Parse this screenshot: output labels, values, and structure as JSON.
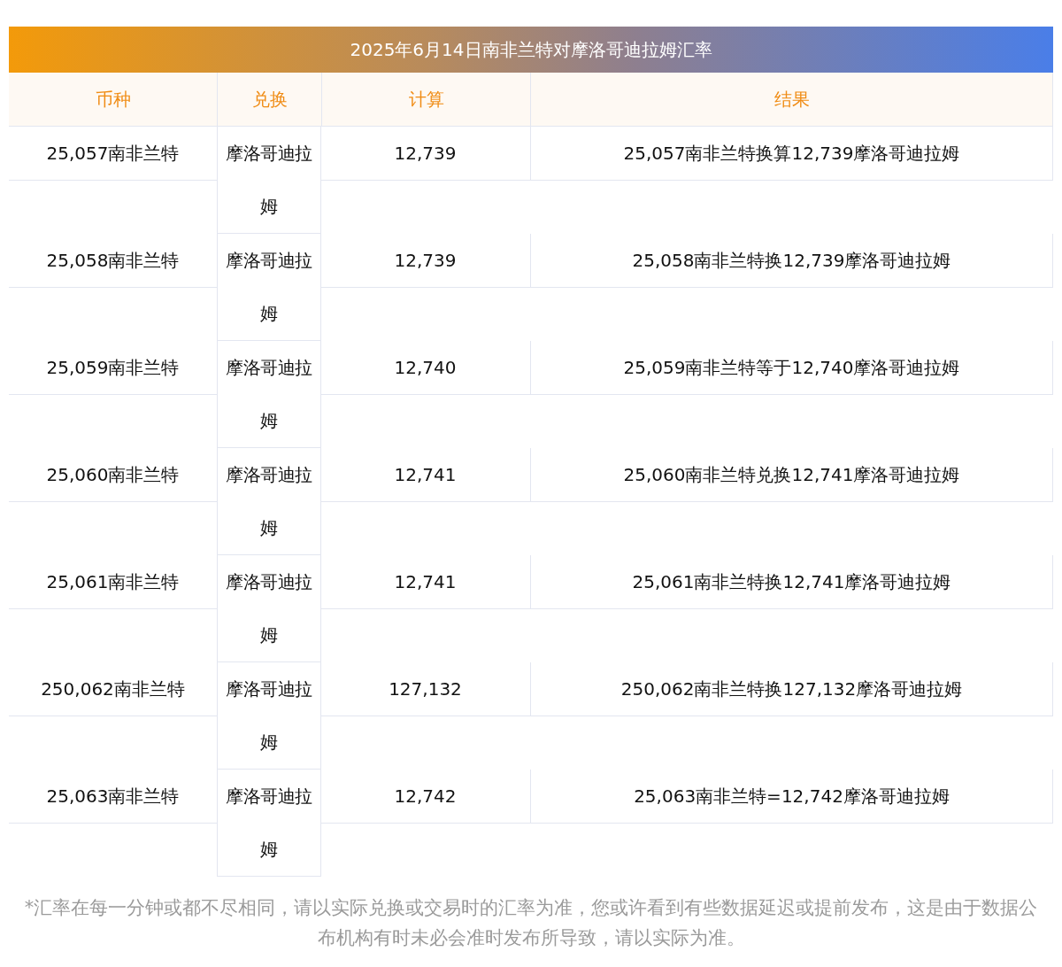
{
  "title": "2025年6月14日南非兰特对摩洛哥迪拉姆汇率",
  "columns": [
    "币种",
    "兑换",
    "计算",
    "结果"
  ],
  "rows": [
    {
      "currency": "25,057南非兰特",
      "exchange": "摩洛哥迪拉姆",
      "amount": "12,739",
      "result": "25,057南非兰特换算12,739摩洛哥迪拉姆"
    },
    {
      "currency": "25,058南非兰特",
      "exchange": "摩洛哥迪拉姆",
      "amount": "12,739",
      "result": "25,058南非兰特换12,739摩洛哥迪拉姆"
    },
    {
      "currency": "25,059南非兰特",
      "exchange": "摩洛哥迪拉姆",
      "amount": "12,740",
      "result": "25,059南非兰特等于12,740摩洛哥迪拉姆"
    },
    {
      "currency": "25,060南非兰特",
      "exchange": "摩洛哥迪拉姆",
      "amount": "12,741",
      "result": "25,060南非兰特兑换12,741摩洛哥迪拉姆"
    },
    {
      "currency": "25,061南非兰特",
      "exchange": "摩洛哥迪拉姆",
      "amount": "12,741",
      "result": "25,061南非兰特换12,741摩洛哥迪拉姆"
    },
    {
      "currency": "250,062南非兰特",
      "exchange": "摩洛哥迪拉姆",
      "amount": "127,132",
      "result": "250,062南非兰特换127,132摩洛哥迪拉姆"
    },
    {
      "currency": "25,063南非兰特",
      "exchange": "摩洛哥迪拉姆",
      "amount": "12,742",
      "result": "25,063南非兰特=12,742摩洛哥迪拉姆"
    }
  ],
  "note": "*汇率在每一分钟或都不尽相同，请以实际兑换或交易时的汇率为准，您或许看到有些数据延迟或提前发布，这是由于数据公布机构有时未必会准时发布所导致，请以实际为准。"
}
